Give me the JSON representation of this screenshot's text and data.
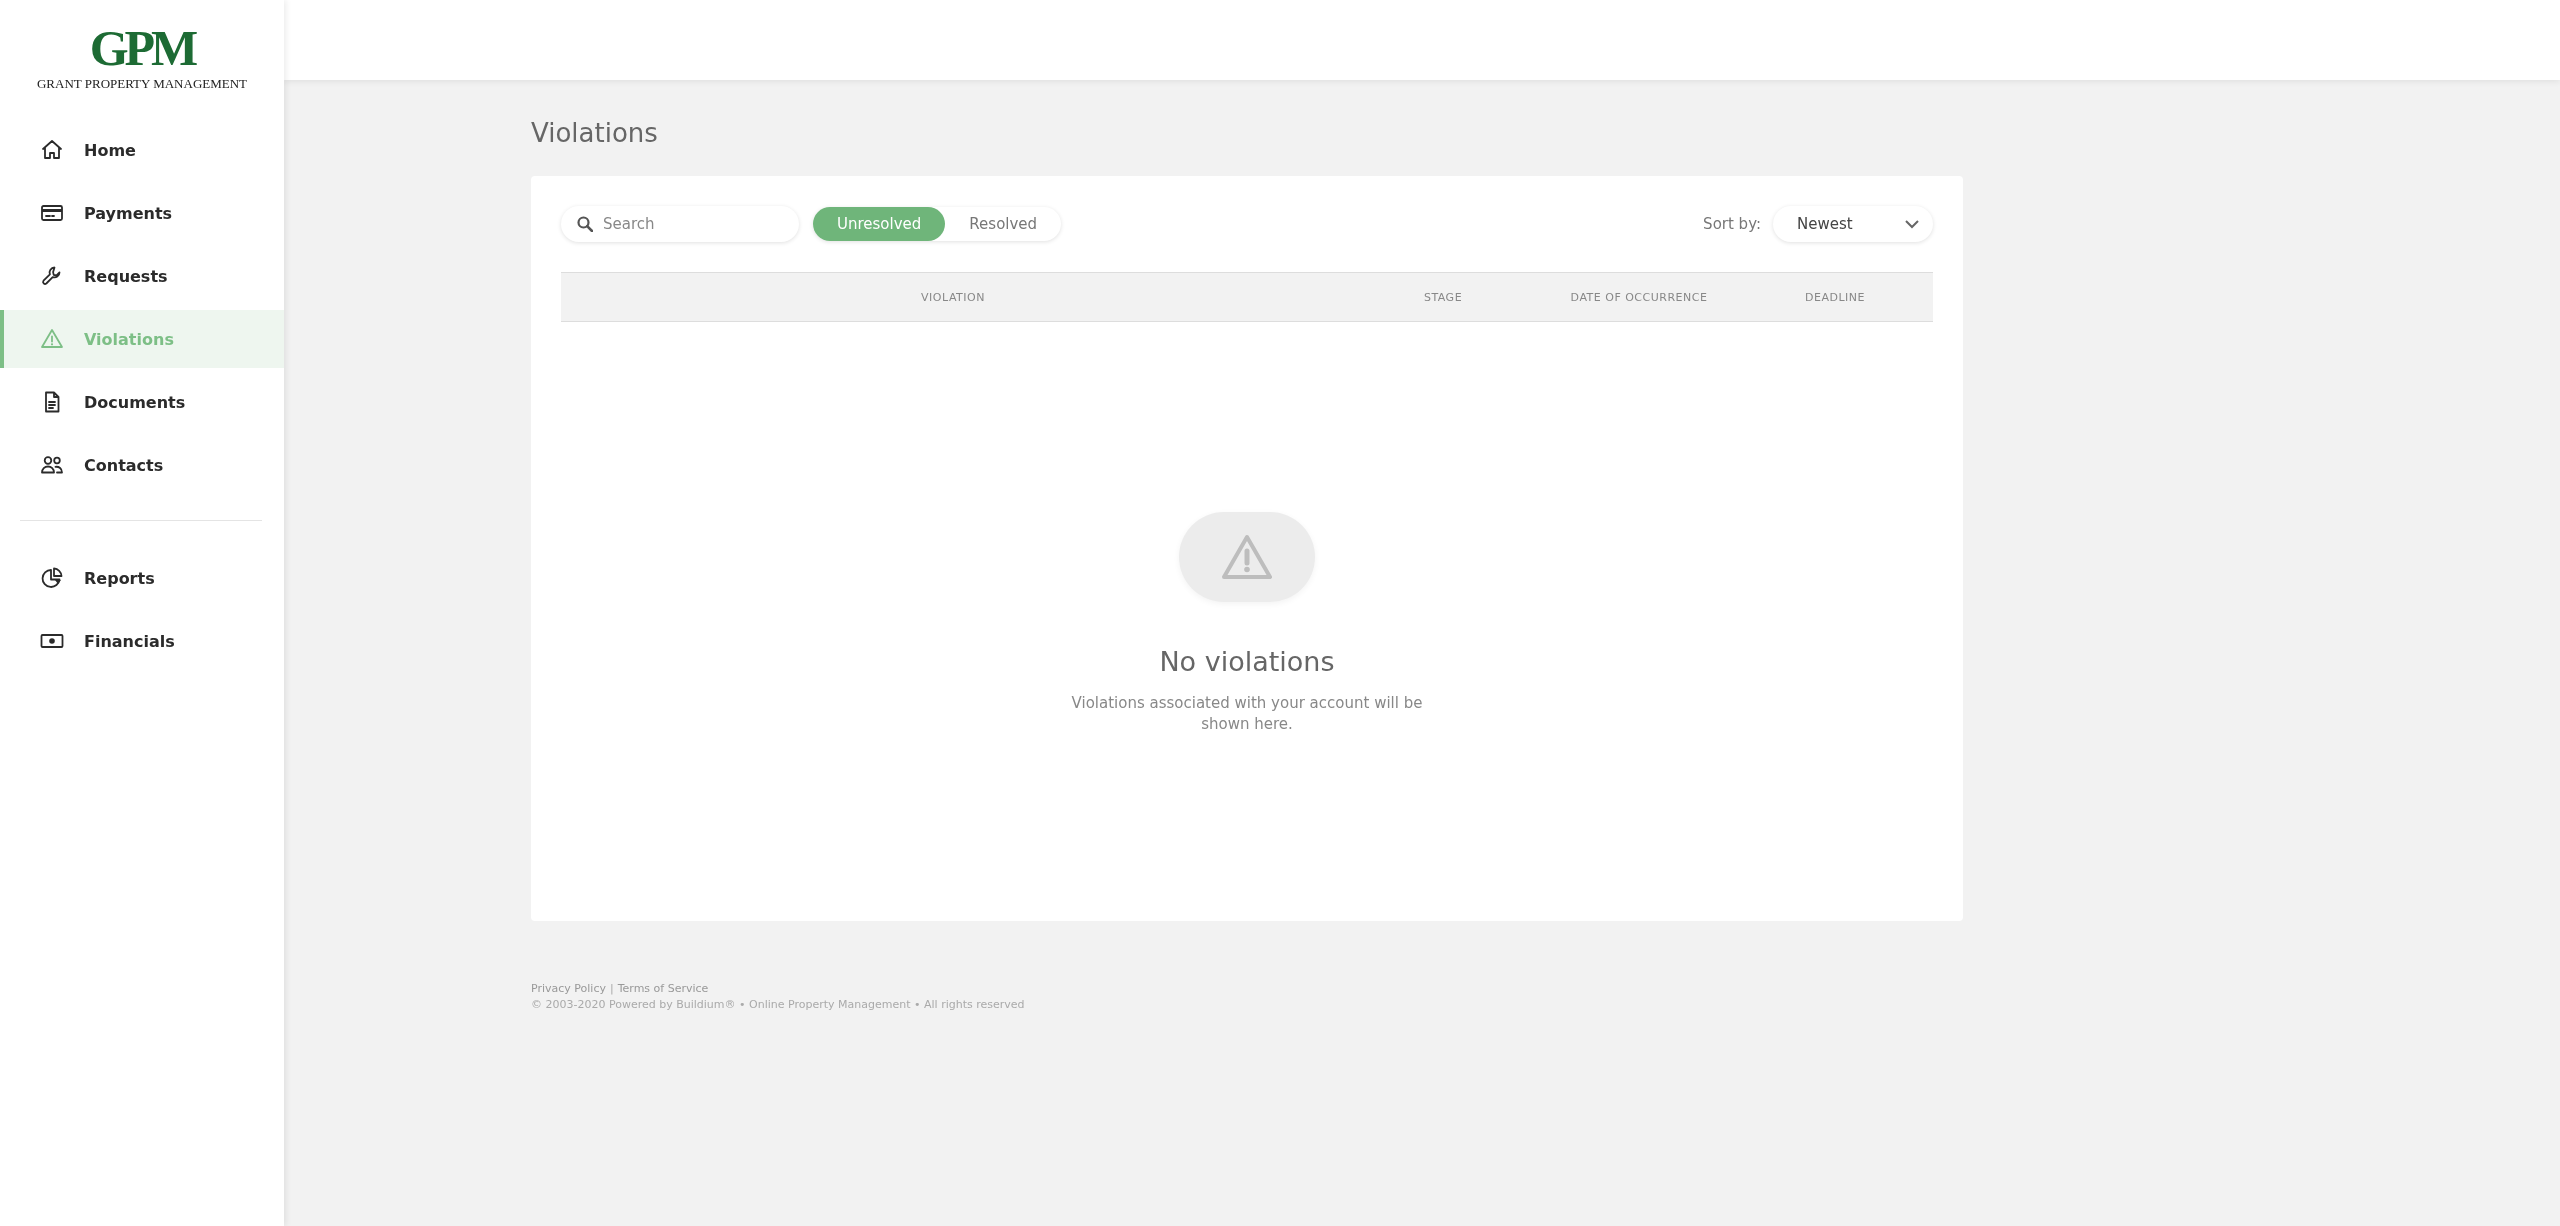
{
  "logo": {
    "mark": "GPM",
    "name": "GRANT PROPERTY MANAGEMENT"
  },
  "sidebar": {
    "groups": [
      {
        "items": [
          {
            "label": "Home",
            "selected": false
          },
          {
            "label": "Payments",
            "selected": false
          },
          {
            "label": "Requests",
            "selected": false
          },
          {
            "label": "Violations",
            "selected": true
          },
          {
            "label": "Documents",
            "selected": false
          },
          {
            "label": "Contacts",
            "selected": false
          }
        ]
      },
      {
        "items": [
          {
            "label": "Reports",
            "selected": false
          },
          {
            "label": "Financials",
            "selected": false
          }
        ]
      }
    ]
  },
  "page": {
    "title": "Violations"
  },
  "search": {
    "placeholder": "Search"
  },
  "filters": [
    {
      "label": "Unresolved",
      "selected": true
    },
    {
      "label": "Resolved",
      "selected": false
    }
  ],
  "sort": {
    "label": "Sort by:",
    "value": "Newest"
  },
  "table": {
    "columns": [
      "VIOLATION",
      "STAGE",
      "DATE OF OCCURRENCE",
      "DEADLINE"
    ]
  },
  "empty": {
    "title": "No violations",
    "message": "Violations associated with your account will be shown here."
  },
  "footer": {
    "links": [
      "Privacy Policy",
      "Terms of Service"
    ],
    "separator": "|",
    "copyright": "© 2003-2020 Powered by Buildium® • Online Property Management • All rights reserved"
  }
}
